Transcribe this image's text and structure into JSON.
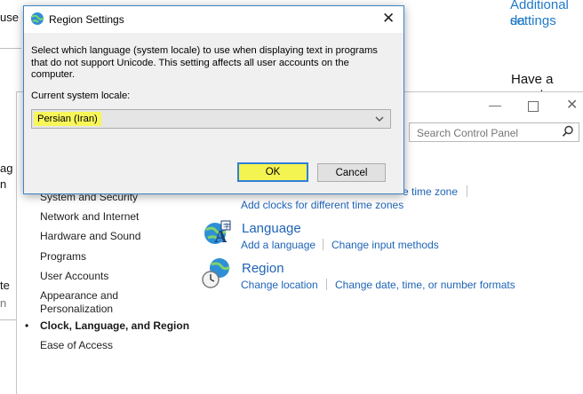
{
  "background": {
    "fragments": [
      "use",
      "ag",
      "n",
      "te",
      "n"
    ],
    "links": [
      "Additional da",
      "settings"
    ],
    "question": "Have a quest"
  },
  "control_panel": {
    "window_buttons": {
      "minimize": "—",
      "close": "✕"
    },
    "search_placeholder": "Search Control Panel",
    "nav": {
      "system_security": "System and Security",
      "network": "Network and Internet",
      "hardware": "Hardware and Sound",
      "programs": "Programs",
      "user_accounts": "User Accounts",
      "appearance": "Appearance and Personalization",
      "clock": "Clock, Language, and Region",
      "ease": "Ease of Access",
      "bullet": "•"
    },
    "clock_section": {
      "link_time_zone": "e time zone",
      "link_clocks": "Add clocks for different time zones"
    },
    "language_section": {
      "title": "Language",
      "add_language": "Add a language",
      "change_input": "Change input methods"
    },
    "region_section": {
      "title": "Region",
      "change_location": "Change location",
      "change_formats": "Change date, time, or number formats"
    }
  },
  "dialog": {
    "title": "Region Settings",
    "close": "✕",
    "description": "Select which language (system locale) to use when displaying text in programs that do not support Unicode. This setting affects all user accounts on the computer.",
    "locale_label": "Current system locale:",
    "locale_value": "Persian (Iran)",
    "ok_label": "OK",
    "cancel_label": "Cancel",
    "highlight_color": "#f7f75a",
    "focus_color": "#2f7fd8"
  }
}
